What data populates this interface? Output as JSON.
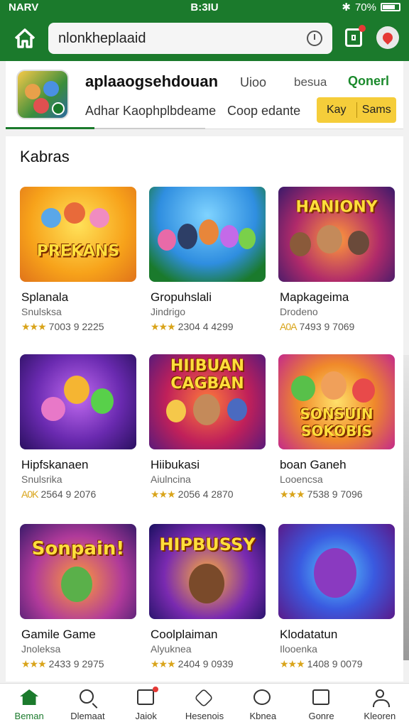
{
  "status": {
    "carrier": "NARV",
    "time": "B:3IU",
    "battery": "70%"
  },
  "topbar": {
    "search_value": "nlonkheplaaid"
  },
  "app": {
    "title": "aplaaogsehdouan",
    "meta1": "Uioo",
    "meta2": "besua",
    "meta3": "Qonerl",
    "sub1": "Adhar Kaophplbdeame",
    "sub2": "Coop edante",
    "btn1": "Kay",
    "btn2": "Sams"
  },
  "section": {
    "title": "Kabras"
  },
  "games": [
    {
      "title": "Splanala",
      "sub": "Snulsksa",
      "stars": "★★★",
      "stats": "7003 9 2225",
      "art": "PREKANS"
    },
    {
      "title": "Gropuhslali",
      "sub": "Jindrigo",
      "stars": "★★★",
      "stats": "2304 4 4299",
      "art": ""
    },
    {
      "title": "Mapkageima",
      "sub": "Drodeno",
      "stars": "A0A",
      "stats": "7493 9 7069",
      "art": "HANIONY"
    },
    {
      "title": "Hipfskanaen",
      "sub": "Snulsrika",
      "stars": "A0K",
      "stats": "2564 9 2076",
      "art": ""
    },
    {
      "title": "Hiibukasi",
      "sub": "Aiulncina",
      "stars": "★★★",
      "stats": "2056 4 2870",
      "art": "HIIBUAN CAGBAN"
    },
    {
      "title": "boan Ganeh",
      "sub": "Looencsa",
      "stars": "★★★",
      "stats": "7538 9 7096",
      "art": "SONSUIN SOKOBIS"
    },
    {
      "title": "Gamile Game",
      "sub": "Jnoleksa",
      "stars": "★★★",
      "stats": "2433 9 2975",
      "art": "Sonpain!"
    },
    {
      "title": "Coolplaiman",
      "sub": "Alyuknea",
      "stars": "★★★",
      "stats": "2404 9 0939",
      "art": "HIPBUSSY"
    },
    {
      "title": "Klodatatun",
      "sub": "Ilooenka",
      "stars": "★★★",
      "stats": "1408 9 0079",
      "art": ""
    }
  ],
  "nav": [
    {
      "label": "Beman",
      "icon": "home-icon"
    },
    {
      "label": "Dlemaat",
      "icon": "search-icon"
    },
    {
      "label": "Jaiok",
      "icon": "library-icon"
    },
    {
      "label": "Hesenois",
      "icon": "shield-icon"
    },
    {
      "label": "Kbnea",
      "icon": "chat-icon"
    },
    {
      "label": "Gonre",
      "icon": "store-icon"
    },
    {
      "label": "Kleoren",
      "icon": "profile-icon"
    }
  ]
}
